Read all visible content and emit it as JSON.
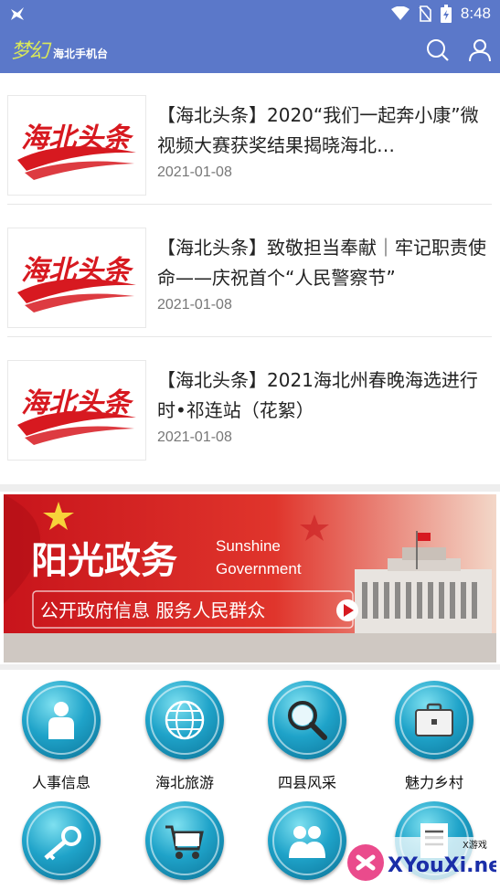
{
  "status_bar": {
    "time": "8:48",
    "icons": [
      "notification-icon",
      "wifi-icon",
      "no-sim-icon",
      "battery-icon"
    ]
  },
  "app_bar": {
    "logo_script": "梦幻",
    "logo_sub": "海北手机台",
    "icons": [
      "search-icon",
      "user-icon"
    ]
  },
  "news": [
    {
      "thumb_text": "海北头条",
      "title": "【海北头条】2020“我们一起奔小康”微视频大赛获奖结果揭晓海北…",
      "date": "2021-01-08"
    },
    {
      "thumb_text": "海北头条",
      "title": "【海北头条】致敬担当奉献｜牢记职责使命——庆祝首个“人民警察节”",
      "date": "2021-01-08"
    },
    {
      "thumb_text": "海北头条",
      "title": "【海北头条】2021海北州春晚海选进行时•祁连站（花絮）",
      "date": "2021-01-08"
    }
  ],
  "banner": {
    "title": "阳光政务",
    "en_line1": "Sunshine",
    "en_line2": "Government",
    "slogan": "公开政府信息 服务人民群众"
  },
  "grid": [
    {
      "label": "人事信息",
      "icon": "person-icon"
    },
    {
      "label": "海北旅游",
      "icon": "globe-icon"
    },
    {
      "label": "四县风采",
      "icon": "magnifier-icon"
    },
    {
      "label": "魅力乡村",
      "icon": "briefcase-icon"
    },
    {
      "label": "",
      "icon": "key-icon"
    },
    {
      "label": "",
      "icon": "cart-icon"
    },
    {
      "label": "",
      "icon": "people-icon"
    },
    {
      "label": "",
      "icon": "document-icon"
    }
  ],
  "watermark": {
    "text": "XYouXi.net",
    "small": "X游戏"
  },
  "colors": {
    "app_bar": "#5b78c9",
    "accent_red": "#d71920",
    "icon_teal": "#1fa3c9"
  }
}
